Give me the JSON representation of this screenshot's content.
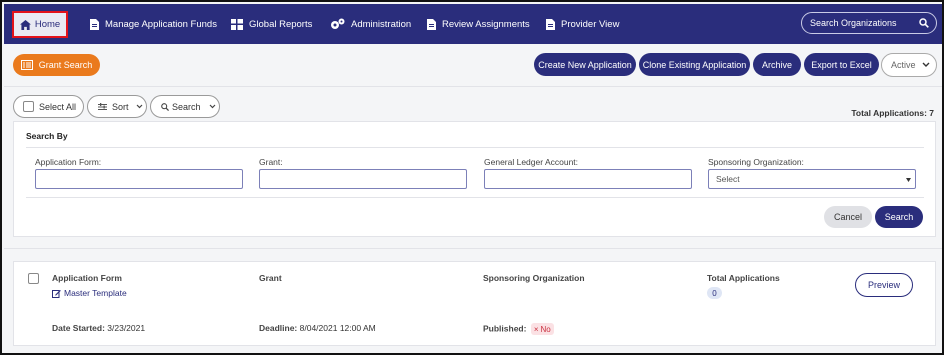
{
  "nav": {
    "home": "Home",
    "manage_funds": "Manage Application Funds",
    "global_reports": "Global Reports",
    "administration": "Administration",
    "review_assignments": "Review Assignments",
    "provider_view": "Provider View",
    "search_placeholder": "Search Organizations"
  },
  "toolbar": {
    "grant_search": "Grant Search",
    "create_new": "Create New Application",
    "clone_existing": "Clone Existing Application",
    "archive": "Archive",
    "export_excel": "Export to Excel",
    "status_filter": "Active"
  },
  "list_controls": {
    "select_all": "Select All",
    "sort": "Sort",
    "search": "Search",
    "total_label": "Total Applications: 7"
  },
  "search_panel": {
    "title": "Search By",
    "fields": {
      "application_form": "Application Form:",
      "grant": "Grant:",
      "gl_account": "General Ledger Account:",
      "sponsoring_org": "Sponsoring Organization:"
    },
    "sponsoring_select_value": "Select",
    "cancel": "Cancel",
    "search": "Search"
  },
  "application": {
    "headers": {
      "form": "Application Form",
      "grant": "Grant",
      "sponsor": "Sponsoring Organization",
      "total": "Total Applications"
    },
    "form_link": "Master Template",
    "total_count": "0",
    "preview": "Preview",
    "date_started_label": "Date Started:",
    "date_started": "3/23/2021",
    "deadline_label": "Deadline:",
    "deadline": "8/04/2021 12:00 AM",
    "published_label": "Published:",
    "published_value": "No"
  },
  "colors": {
    "navy": "#2a2d7c",
    "orange": "#ea7a1d",
    "highlight": "#e3131b"
  },
  "icons": [
    "home-icon",
    "document-icon",
    "grid-icon",
    "gears-icon",
    "document-icon",
    "document-icon",
    "search-icon",
    "list-icon",
    "sort-icon",
    "chevron-down-icon",
    "edit-icon",
    "close-icon"
  ]
}
